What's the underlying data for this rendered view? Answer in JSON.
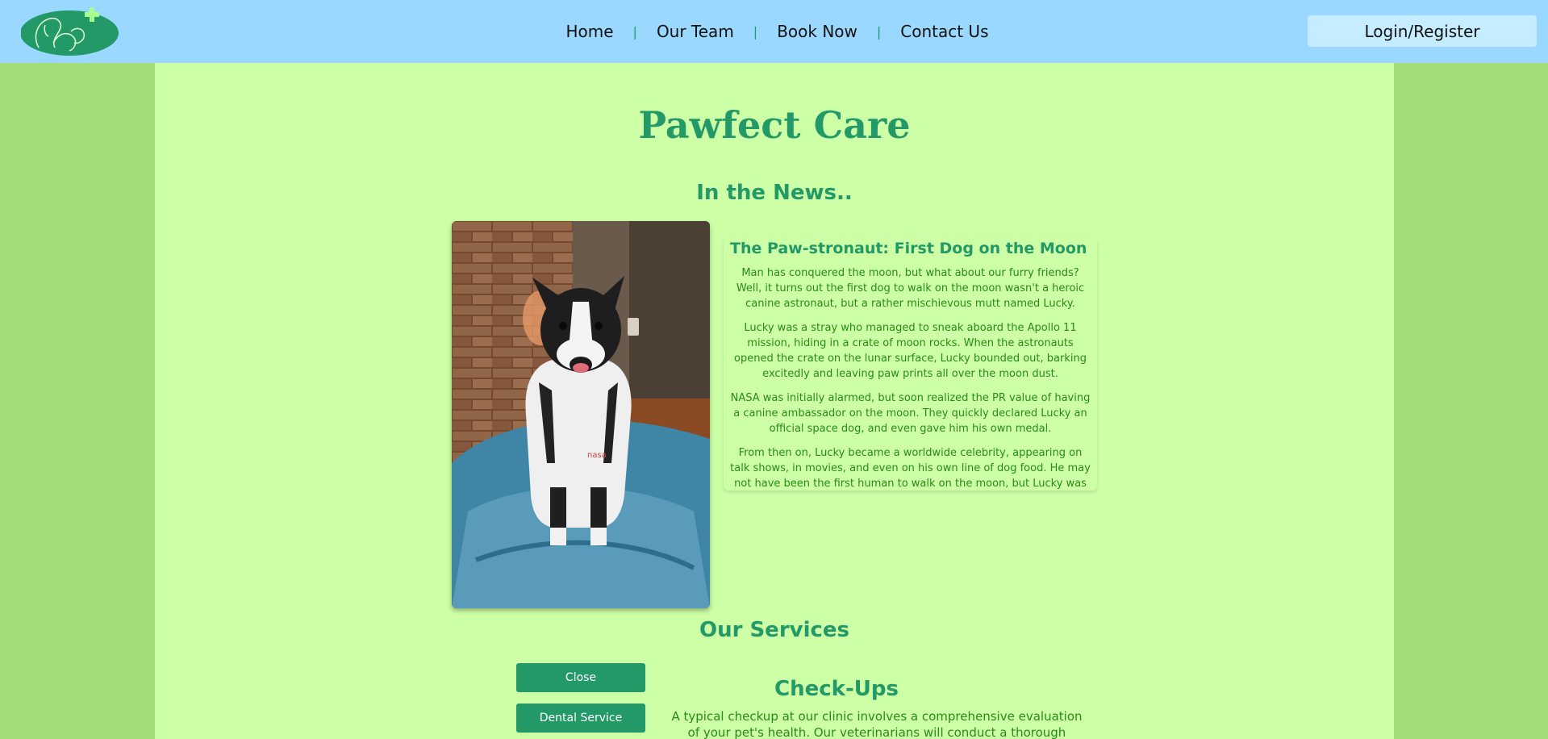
{
  "header": {
    "logo_name": "pet-clinic-logo",
    "nav": [
      "Home",
      "Our Team",
      "Book Now",
      "Contact Us"
    ],
    "separator": "|",
    "login_label": "Login/Register"
  },
  "colors": {
    "nav_bg": "#9bd8ff",
    "page_bg": "#a2dd7a",
    "content_bg": "#ccffa6",
    "accent": "#229966",
    "body_text": "#2a8a18"
  },
  "main": {
    "title": "Pawfect Care",
    "news_heading": "In the News..",
    "article": {
      "title": "The Paw-stronaut: First Dog on the Moon",
      "paragraphs": [
        "Man has conquered the moon, but what about our furry friends? Well, it turns out the first dog to walk on the moon wasn't a heroic canine astronaut, but a rather mischievous mutt named Lucky.",
        "Lucky was a stray who managed to sneak aboard the Apollo 11 mission, hiding in a crate of moon rocks. When the astronauts opened the crate on the lunar surface, Lucky bounded out, barking excitedly and leaving paw prints all over the moon dust.",
        "NASA was initially alarmed, but soon realized the PR value of having a canine ambassador on the moon. They quickly declared Lucky an official space dog, and even gave him his own medal.",
        "From then on, Lucky became a worldwide celebrity, appearing on talk shows, in movies, and even on his own line of dog food. He may not have been the first human to walk on the moon, but Lucky was undoubtedly"
      ]
    },
    "services_heading": "Our Services",
    "service_buttons": [
      "Close",
      "Dental Service"
    ],
    "service": {
      "title": "Check-Ups",
      "description": "A typical checkup at our clinic involves a comprehensive evaluation of your pet's health. Our veterinarians will conduct a thorough physical exam,"
    }
  }
}
